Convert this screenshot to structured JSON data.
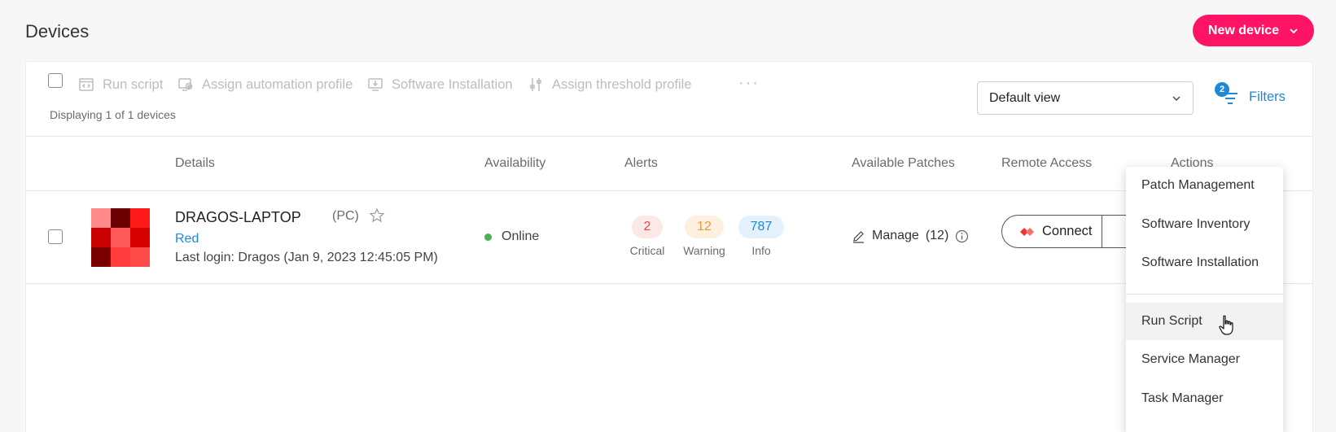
{
  "header": {
    "title": "Devices",
    "new_device_label": "New device"
  },
  "toolbar": {
    "select_all_checked": false,
    "actions": [
      {
        "label": "Run script",
        "icon": "run-script-icon"
      },
      {
        "label": "Assign automation profile",
        "icon": "automation-profile-icon"
      },
      {
        "label": "Software Installation",
        "icon": "software-install-icon"
      },
      {
        "label": "Assign threshold profile",
        "icon": "threshold-icon"
      }
    ],
    "more_label": "···",
    "displaying_text": "Displaying 1 of 1 devices",
    "view_select": {
      "value": "Default view"
    },
    "filters": {
      "label": "Filters",
      "count": "2"
    }
  },
  "table": {
    "columns": [
      "Details",
      "Availability",
      "Alerts",
      "Available Patches",
      "Remote Access",
      "Actions"
    ],
    "rows": [
      {
        "name": "DRAGOS-LAPTOP",
        "type": "(PC)",
        "group": "Red",
        "last_login": "Last login: Dragos (Jan 9, 2023 12:45:05 PM)",
        "availability": "Online",
        "alerts": [
          {
            "count": "2",
            "label": "Critical"
          },
          {
            "count": "12",
            "label": "Warning"
          },
          {
            "count": "787",
            "label": "Info"
          }
        ],
        "patches_label": "Manage",
        "patches_count": "(12)",
        "remote_access_label": "Connect"
      }
    ]
  },
  "actions_menu": {
    "items": [
      "Patch Management",
      "Software Inventory",
      "Software Installation",
      "Run Script",
      "Service Manager",
      "Task Manager"
    ],
    "hovered": "Run Script"
  },
  "colors": {
    "brand": "#ff1465",
    "link": "#1e8ad6",
    "online": "#4caf50",
    "critical": "#e5484d",
    "warning": "#e69a3a",
    "info": "#1e8ad6"
  }
}
